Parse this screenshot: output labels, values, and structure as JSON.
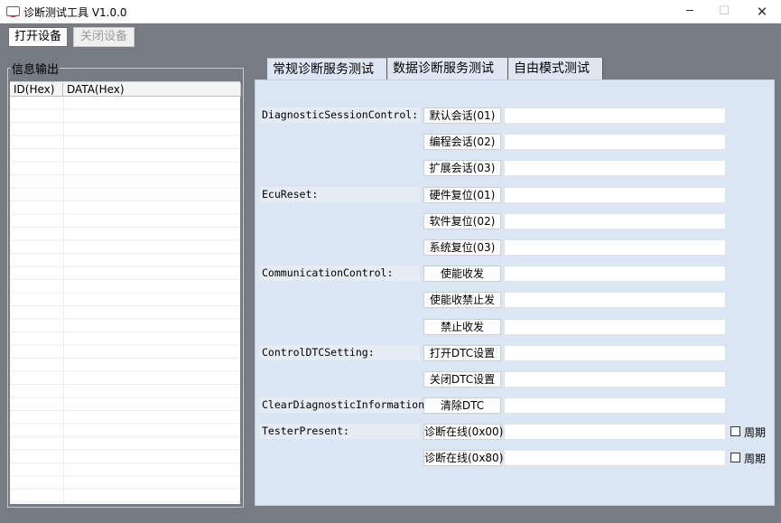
{
  "window": {
    "title": "诊断测试工具 V1.0.0",
    "minimize": "─",
    "maximize": "☐",
    "close": "✕"
  },
  "toolbar": {
    "open_label": "打开设备",
    "close_label": "关闭设备"
  },
  "output": {
    "group_title": "信息输出",
    "columns": [
      "ID(Hex)",
      "DATA(Hex)"
    ]
  },
  "tabs": [
    "常规诊断服务测试",
    "数据诊断服务测试",
    "自由模式测试"
  ],
  "services": [
    {
      "name": "DiagnosticSessionControl:",
      "actions": [
        "默认会话(01)",
        "编程会话(02)",
        "扩展会话(03)"
      ]
    },
    {
      "name": "EcuReset:",
      "actions": [
        "硬件复位(01)",
        "软件复位(02)",
        "系统复位(03)"
      ]
    },
    {
      "name": "CommunicationControl:",
      "actions": [
        "使能收发",
        "使能收禁止发",
        "禁止收发"
      ]
    },
    {
      "name": "ControlDTCSetting:",
      "actions": [
        "打开DTC设置",
        "关闭DTC设置"
      ]
    },
    {
      "name": "ClearDiagnosticInformation",
      "actions": [
        "清除DTC"
      ]
    },
    {
      "name": "TesterPresent:",
      "actions": [
        "诊断在线(0x00)",
        "诊断在线(0x80)"
      ]
    }
  ],
  "periodic_label": "周期",
  "periodic_checked": [
    false,
    false
  ]
}
